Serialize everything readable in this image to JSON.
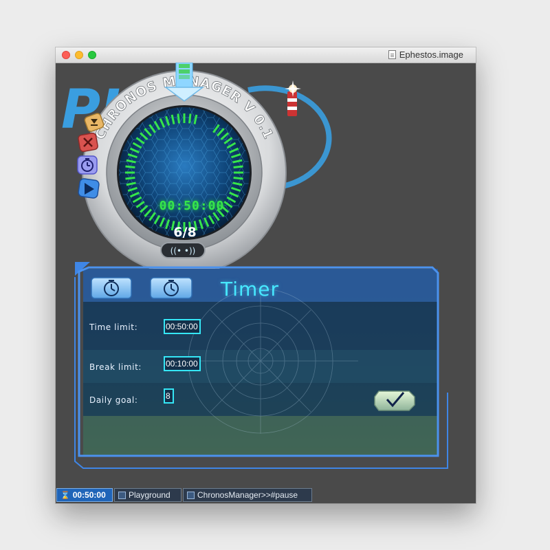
{
  "window": {
    "title": "Ephestos.image"
  },
  "chronos": {
    "logo_text": "PL",
    "ring_text": "CHRONOS MANAGER V 0.1",
    "time_display": "00:50:00",
    "progress": "6/8",
    "side_buttons": [
      "minimize-icon",
      "close-icon",
      "timer-icon",
      "play-icon"
    ]
  },
  "timer_panel": {
    "title": "Timer",
    "fields": {
      "time_limit": {
        "label": "Time limit:",
        "value": "00:50:00"
      },
      "break_limit": {
        "label": "Break limit:",
        "value": "00:10:00"
      },
      "daily_goal": {
        "label": "Daily goal:",
        "value": "8"
      }
    }
  },
  "taskbar": {
    "items": [
      {
        "label": "00:50:00",
        "icon": "hourglass-icon"
      },
      {
        "label": "Playground",
        "icon": "window-icon"
      },
      {
        "label": "ChronosManager>>#pause",
        "icon": "debugger-icon"
      }
    ]
  },
  "colors": {
    "accent": "#47e8ff",
    "digital_green": "#36e64a",
    "panel_border": "#3f86e6"
  }
}
